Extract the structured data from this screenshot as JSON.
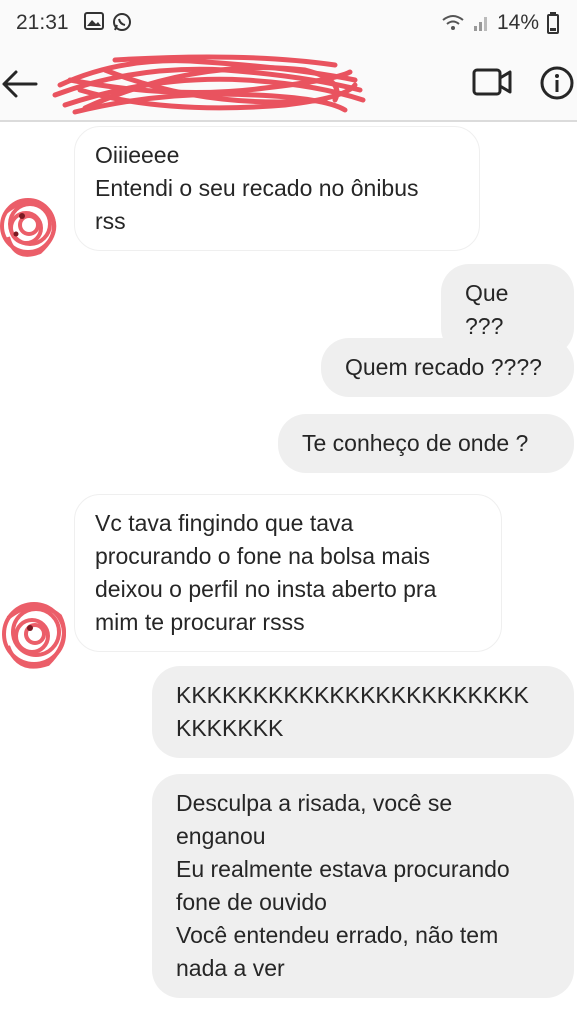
{
  "status_bar": {
    "time": "21:31",
    "battery": "14%",
    "icons": [
      "image-icon",
      "whatsapp-icon",
      "wifi-icon",
      "signal-icon",
      "battery-icon"
    ]
  },
  "header": {
    "contact_name_redacted": true,
    "actions": [
      "video-call-icon",
      "info-icon"
    ]
  },
  "messages": [
    {
      "direction": "incoming",
      "text": "Oiiieeee\nEntendi o seu recado no ônibus\nrss"
    },
    {
      "direction": "outgoing",
      "text": "Que ???"
    },
    {
      "direction": "outgoing",
      "text": "Quem recado ????"
    },
    {
      "direction": "outgoing",
      "text": "Te conheço de onde ?"
    },
    {
      "direction": "incoming",
      "text": "Vc tava fingindo que tava\nprocurando o fone na bolsa mais\ndeixou o perfil no insta aberto pra\nmim te procurar rsss"
    },
    {
      "direction": "outgoing",
      "text": "KKKKKKKKKKKKKKKKKKKKKKK\nKKKKKKK"
    },
    {
      "direction": "outgoing",
      "text": "Desculpa a risada, você se\nenganou\nEu realmente estava procurando\nfone de ouvido\nVocê entendeu errado, não tem\nnada a ver"
    }
  ],
  "colors": {
    "incoming_bubble": "#ffffff",
    "outgoing_bubble": "#efefef",
    "redaction": "#e8424f"
  }
}
